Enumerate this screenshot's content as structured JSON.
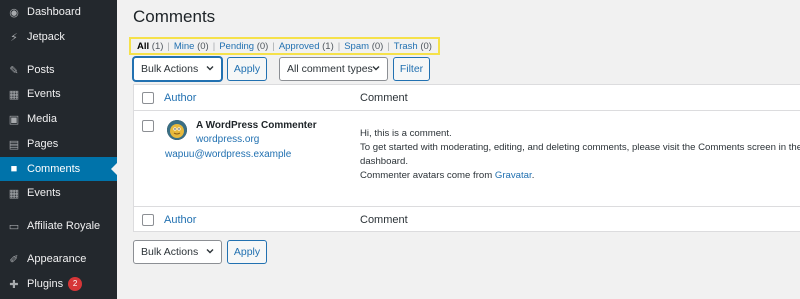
{
  "sidebar": {
    "items": [
      {
        "label": "Dashboard",
        "icon": "dashboard-icon",
        "glyph": "◉"
      },
      {
        "label": "Jetpack",
        "icon": "jetpack-icon",
        "glyph": "⚡"
      },
      {
        "label": "Posts",
        "icon": "pin-icon",
        "glyph": "✎"
      },
      {
        "label": "Events",
        "icon": "calendar-icon",
        "glyph": "▦"
      },
      {
        "label": "Media",
        "icon": "media-icon",
        "glyph": "▣"
      },
      {
        "label": "Pages",
        "icon": "pages-icon",
        "glyph": "▤"
      },
      {
        "label": "Comments",
        "icon": "comment-icon",
        "glyph": "■"
      },
      {
        "label": "Events",
        "icon": "calendar-icon",
        "glyph": "▦"
      },
      {
        "label": "Affiliate Royale",
        "icon": "affiliate-icon",
        "glyph": "▭"
      },
      {
        "label": "Appearance",
        "icon": "appearance-icon",
        "glyph": "✐"
      },
      {
        "label": "Plugins",
        "icon": "plugin-icon",
        "glyph": "✚",
        "badge": "2"
      }
    ]
  },
  "page": {
    "title": "Comments"
  },
  "filters": {
    "all": "All",
    "all_count": "(1)",
    "mine": "Mine",
    "mine_count": "(0)",
    "pending": "Pending",
    "pending_count": "(0)",
    "approved": "Approved",
    "approved_count": "(1)",
    "spam": "Spam",
    "spam_count": "(0)",
    "trash": "Trash",
    "trash_count": "(0)",
    "separator": "|"
  },
  "top_controls": {
    "bulk_actions": "Bulk Actions",
    "apply": "Apply",
    "comment_types": "All comment types",
    "filter": "Filter"
  },
  "table": {
    "col_author": "Author",
    "col_comment": "Comment",
    "rows": [
      {
        "author_name": "A WordPress Commenter",
        "author_url": "wordpress.org",
        "author_email": "wapuu@wordpress.example",
        "line1": "Hi, this is a comment.",
        "line2": "To get started with moderating, editing, and deleting comments, please visit the Comments screen in the dashboard.",
        "line3_prefix": "Commenter avatars come from ",
        "line3_link": "Gravatar",
        "line3_suffix": "."
      }
    ]
  },
  "bottom_controls": {
    "bulk_actions": "Bulk Actions",
    "apply": "Apply"
  },
  "colors": {
    "sidebar_bg": "#23282d",
    "active_bg": "#0073aa",
    "link": "#2271b1",
    "highlight_border": "#f5e14a"
  }
}
